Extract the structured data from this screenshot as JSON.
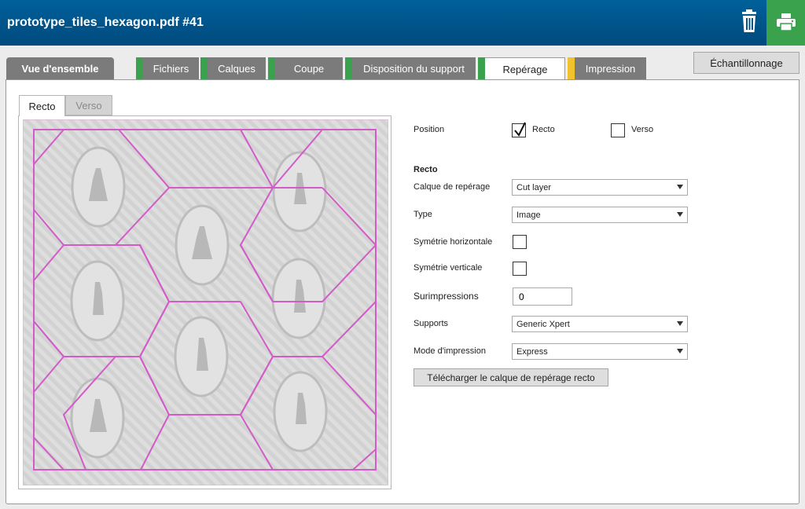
{
  "window": {
    "title": "prototype_tiles_hexagon.pdf #41"
  },
  "header": {
    "delete_icon": "trash-icon",
    "print_icon": "printer-icon",
    "print_color": "#3aa14c"
  },
  "tabs": [
    {
      "label": "Vue d'ensemble",
      "indicator": ""
    },
    {
      "label": "Fichiers",
      "indicator": "#3aa14c"
    },
    {
      "label": "Calques",
      "indicator": "#3aa14c"
    },
    {
      "label": "Coupe",
      "indicator": "#3aa14c"
    },
    {
      "label": "Disposition du support",
      "indicator": "#3aa14c"
    },
    {
      "label": "Repérage",
      "indicator": "#3aa14c",
      "active": true
    },
    {
      "label": "Impression",
      "indicator": "#f2c12e"
    }
  ],
  "sampling_button": "Échantillonnage",
  "subtabs": {
    "recto": "Recto",
    "verso": "Verso"
  },
  "form": {
    "position_label": "Position",
    "position_recto": {
      "label": "Recto",
      "checked": true
    },
    "position_verso": {
      "label": "Verso",
      "checked": false
    },
    "section_title": "Recto",
    "calque_label": "Calque de repérage",
    "calque_value": "Cut layer",
    "type_label": "Type",
    "type_value": "Image",
    "sym_h_label": "Symétrie horizontale",
    "sym_v_label": "Symétrie verticale",
    "surimp_label": "Surimpressions",
    "surimp_value": "0",
    "supports_label": "Supports",
    "supports_value": "Generic Xpert",
    "mode_label": "Mode d'impression",
    "mode_value": "Express",
    "download_button": "Télécharger le calque de repérage recto"
  },
  "preview": {
    "cut_line_color": "#d25bc8",
    "tile_count": 7
  }
}
